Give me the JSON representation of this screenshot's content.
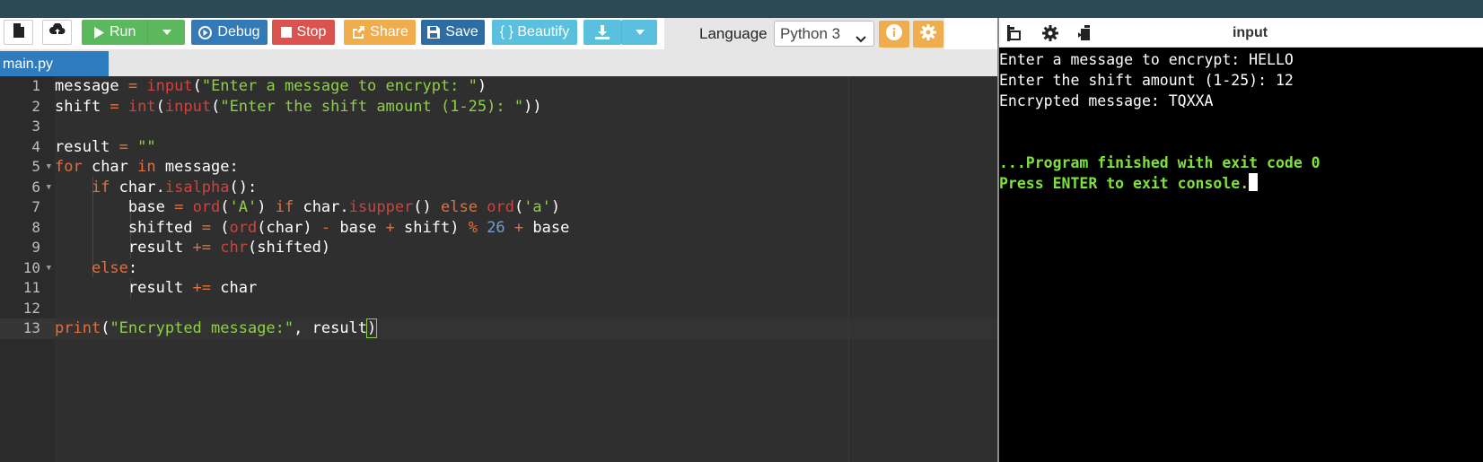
{
  "toolbar": {
    "new_file_icon": "file-icon",
    "upload_icon": "cloud-upload-icon",
    "run_label": "Run",
    "debug_label": "Debug",
    "stop_label": "Stop",
    "share_label": "Share",
    "save_label": "Save",
    "beautify_label": "{ } Beautify",
    "language_label": "Language",
    "language_value": "Python 3",
    "colors": {
      "run": "#5cb85c",
      "debug": "#337ab7",
      "stop": "#d9534f",
      "share": "#f0ad4e",
      "save": "#2e6da4",
      "beautify": "#5bc0de",
      "download": "#5bc0de",
      "info": "#f0ad4e",
      "settings": "#f0ad4e"
    }
  },
  "editor": {
    "tab_label": "main.py",
    "line_numbers": [
      "1",
      "2",
      "3",
      "4",
      "5",
      "6",
      "7",
      "8",
      "9",
      "10",
      "11",
      "12",
      "13"
    ],
    "active_line": 13,
    "lines": [
      [
        [
          "",
          "message "
        ],
        [
          "op",
          "="
        ],
        [
          "",
          " "
        ],
        [
          "fn",
          "input"
        ],
        [
          "",
          "("
        ],
        [
          "str",
          "\"Enter a message to encrypt: \""
        ],
        [
          "",
          ")"
        ]
      ],
      [
        [
          "",
          "shift "
        ],
        [
          "op",
          "="
        ],
        [
          "",
          " "
        ],
        [
          "fn",
          "int"
        ],
        [
          "",
          "("
        ],
        [
          "fn",
          "input"
        ],
        [
          "",
          "("
        ],
        [
          "str",
          "\"Enter the shift amount (1-25): \""
        ],
        [
          "",
          "))"
        ]
      ],
      [],
      [
        [
          "",
          "result "
        ],
        [
          "op",
          "="
        ],
        [
          "",
          " "
        ],
        [
          "str",
          "\"\""
        ]
      ],
      [
        [
          "kw",
          "for"
        ],
        [
          "",
          " char "
        ],
        [
          "kw",
          "in"
        ],
        [
          "",
          " message:"
        ]
      ],
      [
        [
          "",
          "    "
        ],
        [
          "kw",
          "if"
        ],
        [
          "",
          " char."
        ],
        [
          "fn",
          "isalpha"
        ],
        [
          "",
          "():"
        ]
      ],
      [
        [
          "",
          "        base "
        ],
        [
          "op",
          "="
        ],
        [
          "",
          " "
        ],
        [
          "fn",
          "ord"
        ],
        [
          "",
          "("
        ],
        [
          "str",
          "'A'"
        ],
        [
          "",
          ") "
        ],
        [
          "kw",
          "if"
        ],
        [
          "",
          " char."
        ],
        [
          "fn",
          "isupper"
        ],
        [
          "",
          "() "
        ],
        [
          "kw",
          "else"
        ],
        [
          "",
          " "
        ],
        [
          "fn",
          "ord"
        ],
        [
          "",
          "("
        ],
        [
          "str",
          "'a'"
        ],
        [
          "",
          ")"
        ]
      ],
      [
        [
          "",
          "        shifted "
        ],
        [
          "op",
          "="
        ],
        [
          "",
          " ("
        ],
        [
          "fn",
          "ord"
        ],
        [
          "",
          "(char) "
        ],
        [
          "op",
          "-"
        ],
        [
          "",
          " base "
        ],
        [
          "op",
          "+"
        ],
        [
          "",
          " shift) "
        ],
        [
          "op",
          "%"
        ],
        [
          "",
          " "
        ],
        [
          "num",
          "26"
        ],
        [
          "",
          " "
        ],
        [
          "op",
          "+"
        ],
        [
          "",
          " base"
        ]
      ],
      [
        [
          "",
          "        result "
        ],
        [
          "op",
          "+="
        ],
        [
          "",
          " "
        ],
        [
          "fn",
          "chr"
        ],
        [
          "",
          "(shifted)"
        ]
      ],
      [
        [
          "",
          "    "
        ],
        [
          "kw",
          "else"
        ],
        [
          "",
          ":"
        ]
      ],
      [
        [
          "",
          "        result "
        ],
        [
          "op",
          "+="
        ],
        [
          "",
          " char"
        ]
      ],
      [],
      [
        [
          "kw",
          "print"
        ],
        [
          "",
          "("
        ],
        [
          "str",
          "\"Encrypted message:\""
        ],
        [
          "",
          ", result"
        ],
        [
          "cursor",
          ")"
        ]
      ]
    ]
  },
  "console": {
    "title": "input",
    "header_icons": [
      "stop-console-icon",
      "settings-icon",
      "copy-icon"
    ],
    "lines": [
      {
        "text": "Enter a message to encrypt: HELLO",
        "style": "normal"
      },
      {
        "text": "Enter the shift amount (1-25): 12",
        "style": "normal"
      },
      {
        "text": "Encrypted message: TQXXA",
        "style": "normal"
      },
      {
        "text": "",
        "style": "normal"
      },
      {
        "text": "",
        "style": "normal"
      },
      {
        "text": "...Program finished with exit code 0",
        "style": "green"
      },
      {
        "text": "Press ENTER to exit console.",
        "style": "green"
      }
    ]
  }
}
